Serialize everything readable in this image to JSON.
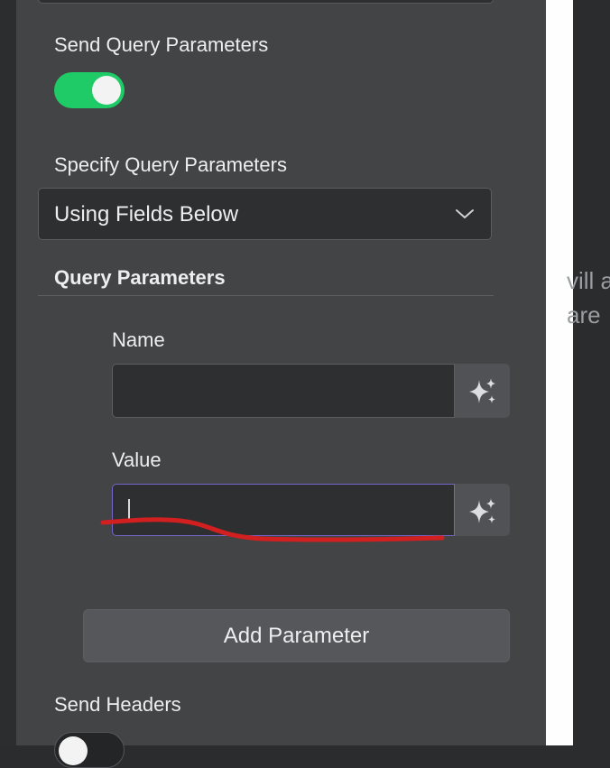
{
  "send_query_parameters": {
    "label": "Send Query Parameters",
    "enabled": true
  },
  "specify_query_parameters": {
    "label": "Specify Query Parameters",
    "selected": "Using Fields Below"
  },
  "query_parameters": {
    "heading": "Query Parameters",
    "name_label": "Name",
    "name_value": "",
    "value_label": "Value",
    "value_value": "",
    "add_button": "Add Parameter"
  },
  "send_headers": {
    "label": "Send Headers",
    "enabled": false
  },
  "background_text": {
    "line1": "vill a",
    "line2": "are"
  },
  "icons": {
    "toggle": "toggle-switch",
    "dropdown": "chevron-down-icon",
    "ai": "sparkles-icon"
  },
  "colors": {
    "toggle_on": "#1ecb66",
    "focus_border": "#7664c8",
    "annotation_stroke": "#d21f1f"
  }
}
